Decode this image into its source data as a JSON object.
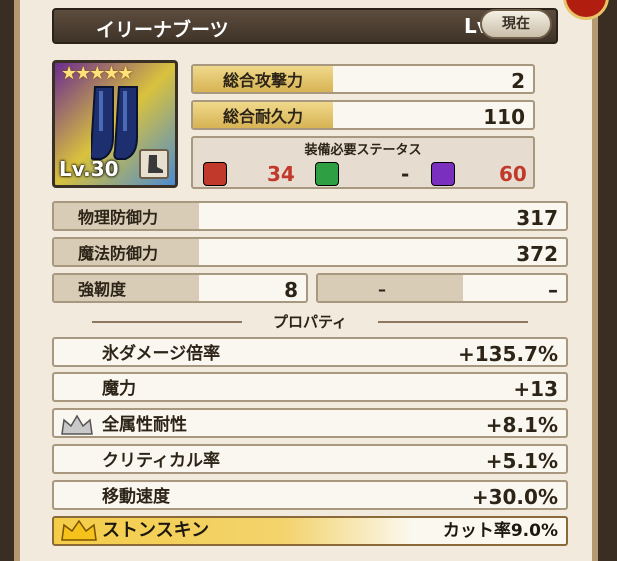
{
  "header": {
    "item_name": "イリーナブーツ",
    "level": "Lv.30",
    "current_label": "現在"
  },
  "item": {
    "level_badge": "Lv.30",
    "stars": "★★★★★"
  },
  "totals": [
    {
      "label": "総合攻撃力",
      "value": "2"
    },
    {
      "label": "総合耐久力",
      "value": "110"
    }
  ],
  "requirements": {
    "title": "装備必要ステータス",
    "items": [
      {
        "icon": "fist-icon",
        "value": "34",
        "color": "#c0392b"
      },
      {
        "icon": "agility-icon",
        "value": "-",
        "color": "#2ea043"
      },
      {
        "icon": "magic-icon",
        "value": "60",
        "color": "#7b2fbf"
      }
    ]
  },
  "stats": [
    {
      "label": "物理防御力",
      "value": "317"
    },
    {
      "label": "魔法防御力",
      "value": "372"
    }
  ],
  "toughness": {
    "label": "強靭度",
    "value": "8",
    "dash_label": "–",
    "dash_value": "–"
  },
  "properties_title": "プロパティ",
  "properties": [
    {
      "label": "氷ダメージ倍率",
      "value": "+135.7%"
    },
    {
      "label": "魔力",
      "value": "+13"
    },
    {
      "label": "全属性耐性",
      "value": "+8.1%",
      "crown": "silver"
    },
    {
      "label": "クリティカル率",
      "value": "+5.1%"
    },
    {
      "label": "移動速度",
      "value": "+30.0%"
    }
  ],
  "special": {
    "name": "ストンスキン",
    "value": "カット率9.0%"
  }
}
